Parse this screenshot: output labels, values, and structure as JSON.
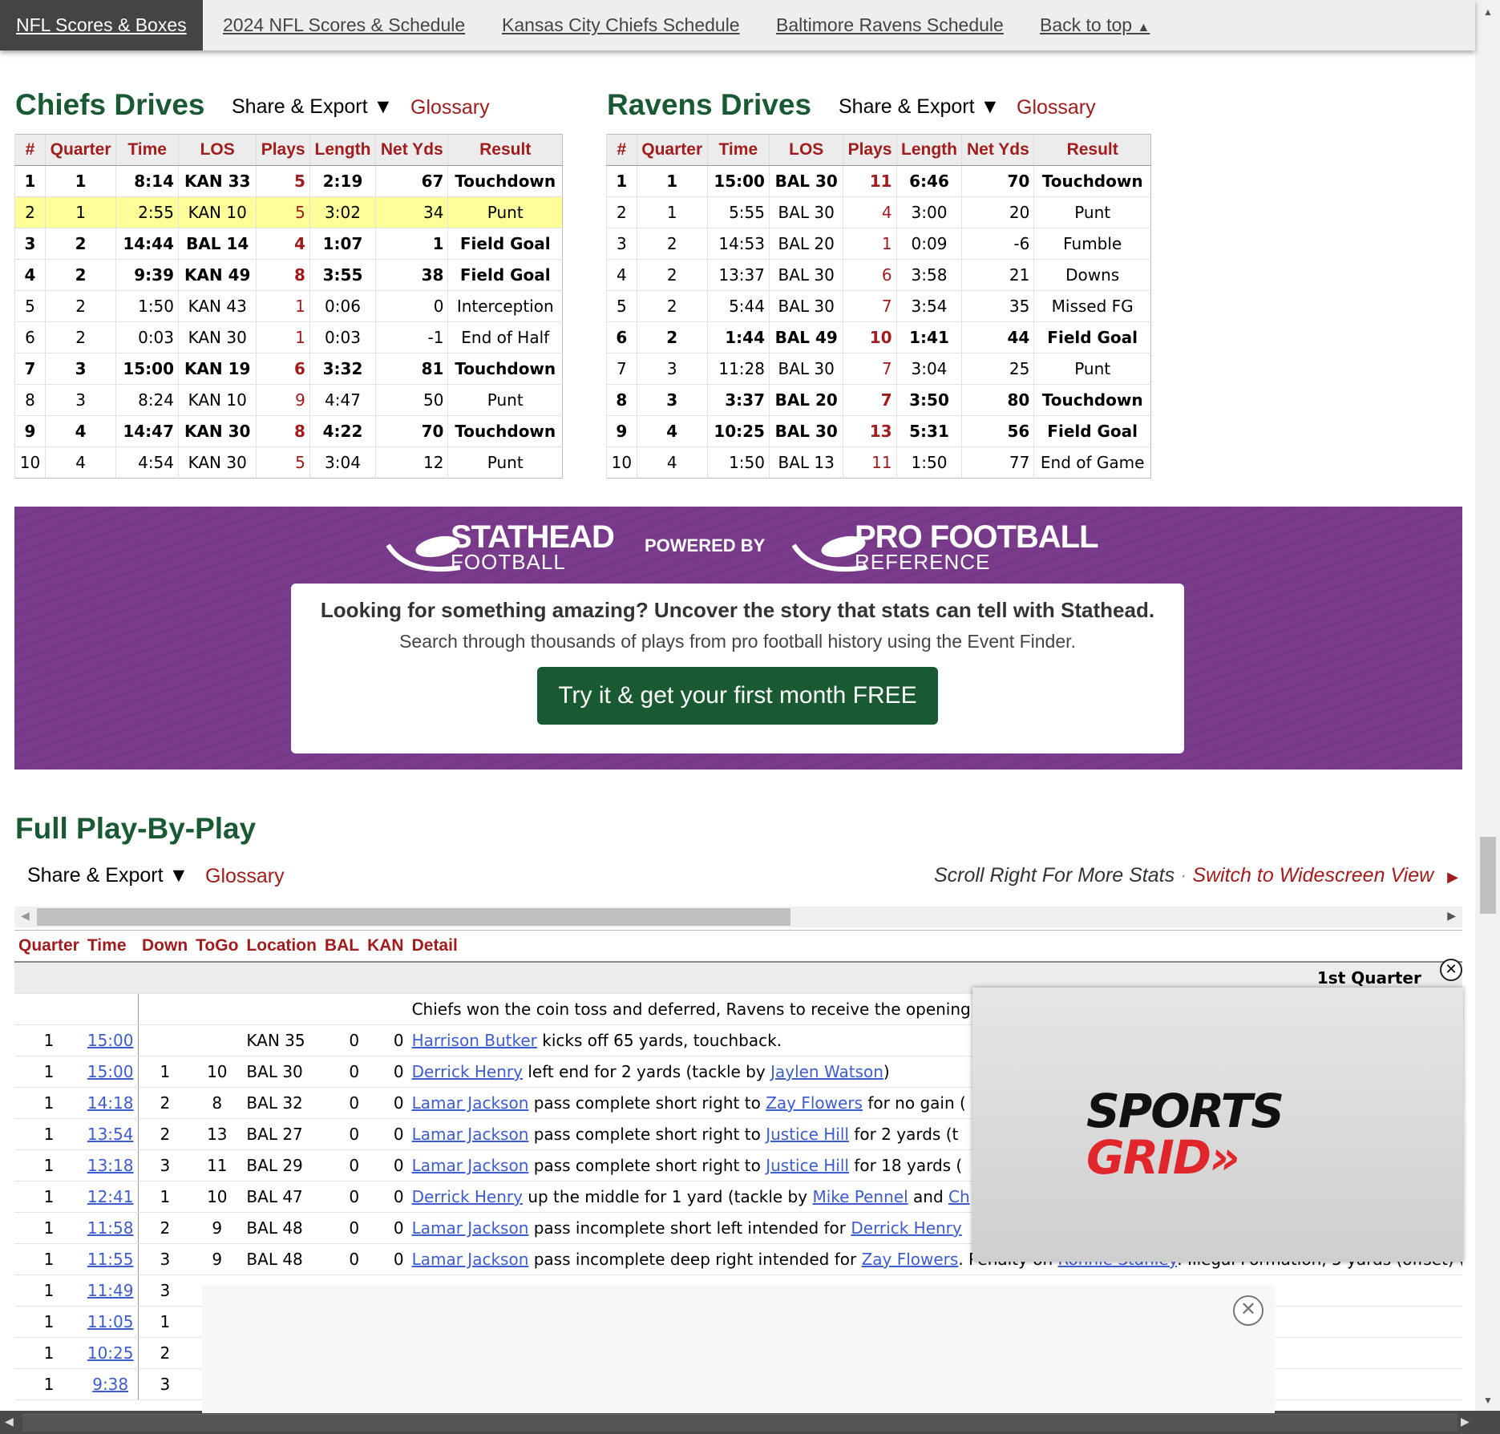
{
  "topnav": {
    "items": [
      "NFL Scores & Boxes",
      "2024 NFL Scores & Schedule",
      "Kansas City Chiefs Schedule",
      "Baltimore Ravens Schedule",
      "Back to top"
    ]
  },
  "chiefs": {
    "title": "Chiefs Drives",
    "share": "Share & Export ▼",
    "glossary": "Glossary",
    "columns": [
      "#",
      "Quarter",
      "Time",
      "LOS",
      "Plays",
      "Length",
      "Net Yds",
      "Result"
    ],
    "rows": [
      [
        "1",
        "1",
        "8:14",
        "KAN 33",
        "5",
        "2:19",
        "67",
        "Touchdown"
      ],
      [
        "2",
        "1",
        "2:55",
        "KAN 10",
        "5",
        "3:02",
        "34",
        "Punt"
      ],
      [
        "3",
        "2",
        "14:44",
        "BAL 14",
        "4",
        "1:07",
        "1",
        "Field Goal"
      ],
      [
        "4",
        "2",
        "9:39",
        "KAN 49",
        "8",
        "3:55",
        "38",
        "Field Goal"
      ],
      [
        "5",
        "2",
        "1:50",
        "KAN 43",
        "1",
        "0:06",
        "0",
        "Interception"
      ],
      [
        "6",
        "2",
        "0:03",
        "KAN 30",
        "1",
        "0:03",
        "-1",
        "End of Half"
      ],
      [
        "7",
        "3",
        "15:00",
        "KAN 19",
        "6",
        "3:32",
        "81",
        "Touchdown"
      ],
      [
        "8",
        "3",
        "8:24",
        "KAN 10",
        "9",
        "4:47",
        "50",
        "Punt"
      ],
      [
        "9",
        "4",
        "14:47",
        "KAN 30",
        "8",
        "4:22",
        "70",
        "Touchdown"
      ],
      [
        "10",
        "4",
        "4:54",
        "KAN 30",
        "5",
        "3:04",
        "12",
        "Punt"
      ]
    ]
  },
  "ravens": {
    "title": "Ravens Drives",
    "share": "Share & Export ▼",
    "glossary": "Glossary",
    "columns": [
      "#",
      "Quarter",
      "Time",
      "LOS",
      "Plays",
      "Length",
      "Net Yds",
      "Result"
    ],
    "rows": [
      [
        "1",
        "1",
        "15:00",
        "BAL 30",
        "11",
        "6:46",
        "70",
        "Touchdown"
      ],
      [
        "2",
        "1",
        "5:55",
        "BAL 30",
        "4",
        "3:00",
        "20",
        "Punt"
      ],
      [
        "3",
        "2",
        "14:53",
        "BAL 20",
        "1",
        "0:09",
        "-6",
        "Fumble"
      ],
      [
        "4",
        "2",
        "13:37",
        "BAL 30",
        "6",
        "3:58",
        "21",
        "Downs"
      ],
      [
        "5",
        "2",
        "5:44",
        "BAL 30",
        "7",
        "3:54",
        "35",
        "Missed FG"
      ],
      [
        "6",
        "2",
        "1:44",
        "BAL 49",
        "10",
        "1:41",
        "44",
        "Field Goal"
      ],
      [
        "7",
        "3",
        "11:28",
        "BAL 30",
        "7",
        "3:04",
        "25",
        "Punt"
      ],
      [
        "8",
        "3",
        "3:37",
        "BAL 20",
        "7",
        "3:50",
        "80",
        "Touchdown"
      ],
      [
        "9",
        "4",
        "10:25",
        "BAL 30",
        "13",
        "5:31",
        "56",
        "Field Goal"
      ],
      [
        "10",
        "4",
        "1:50",
        "BAL 13",
        "11",
        "1:50",
        "77",
        "End of Game"
      ]
    ]
  },
  "promo": {
    "stathead_big": "STATHEAD",
    "stathead_small": "FOOTBALL",
    "powered_by": "POWERED BY",
    "pfr_big": "PRO FOOTBALL",
    "pfr_small": "REFERENCE",
    "headline": "Looking for something amazing? Uncover the story that stats can tell with Stathead.",
    "subline": "Search through thousands of plays from pro football history using the Event Finder.",
    "cta": "Try it & get your first month FREE"
  },
  "pbp": {
    "title": "Full Play-By-Play",
    "share": "Share & Export ▼",
    "glossary": "Glossary",
    "scroll_note": "Scroll Right For More Stats",
    "widescreen": "Switch to Widescreen View",
    "columns": [
      "Quarter",
      "Time",
      "Down",
      "ToGo",
      "Location",
      "BAL",
      "KAN",
      "Detail"
    ],
    "quarter_label": "1st Quarter",
    "coin_toss": "Chiefs won the coin toss and deferred, Ravens to receive the opening kickoff.",
    "rows": [
      {
        "q": "1",
        "time": "15:00",
        "down": "",
        "togo": "",
        "loc": "KAN 35",
        "bal": "0",
        "kan": "0",
        "parts": [
          {
            "link": "Harrison Butker"
          },
          {
            "text": " kicks off 65 yards, touchback."
          }
        ]
      },
      {
        "q": "1",
        "time": "15:00",
        "down": "1",
        "togo": "10",
        "loc": "BAL 30",
        "bal": "0",
        "kan": "0",
        "parts": [
          {
            "link": "Derrick Henry"
          },
          {
            "text": " left end for 2 yards (tackle by "
          },
          {
            "link": "Jaylen Watson"
          },
          {
            "text": ")"
          }
        ]
      },
      {
        "q": "1",
        "time": "14:18",
        "down": "2",
        "togo": "8",
        "loc": "BAL 32",
        "bal": "0",
        "kan": "0",
        "parts": [
          {
            "link": "Lamar Jackson"
          },
          {
            "text": " pass complete short right to "
          },
          {
            "link": "Zay Flowers"
          },
          {
            "text": " for no gain ("
          }
        ]
      },
      {
        "q": "1",
        "time": "13:54",
        "down": "2",
        "togo": "13",
        "loc": "BAL 27",
        "bal": "0",
        "kan": "0",
        "parts": [
          {
            "link": "Lamar Jackson"
          },
          {
            "text": " pass complete short right to "
          },
          {
            "link": "Justice Hill"
          },
          {
            "text": " for 2 yards (t"
          }
        ]
      },
      {
        "q": "1",
        "time": "13:18",
        "down": "3",
        "togo": "11",
        "loc": "BAL 29",
        "bal": "0",
        "kan": "0",
        "parts": [
          {
            "link": "Lamar Jackson"
          },
          {
            "text": " pass complete short right to "
          },
          {
            "link": "Justice Hill"
          },
          {
            "text": " for 18 yards ("
          }
        ]
      },
      {
        "q": "1",
        "time": "12:41",
        "down": "1",
        "togo": "10",
        "loc": "BAL 47",
        "bal": "0",
        "kan": "0",
        "parts": [
          {
            "link": "Derrick Henry"
          },
          {
            "text": " up the middle for 1 yard (tackle by "
          },
          {
            "link": "Mike Pennel"
          },
          {
            "text": " and "
          },
          {
            "link": "Ch"
          }
        ]
      },
      {
        "q": "1",
        "time": "11:58",
        "down": "2",
        "togo": "9",
        "loc": "BAL 48",
        "bal": "0",
        "kan": "0",
        "parts": [
          {
            "link": "Lamar Jackson"
          },
          {
            "text": " pass incomplete short left intended for "
          },
          {
            "link": "Derrick Henry"
          }
        ]
      },
      {
        "q": "1",
        "time": "11:55",
        "down": "3",
        "togo": "9",
        "loc": "BAL 48",
        "bal": "0",
        "kan": "0",
        "parts": [
          {
            "link": "Lamar Jackson"
          },
          {
            "text": " pass incomplete deep right intended for "
          },
          {
            "link": "Zay Flowers"
          },
          {
            "text": ". Penalty on "
          },
          {
            "link": "Ronnie Stanley"
          },
          {
            "text": ": Illegal Formation, 5 yards (offset) ("
          }
        ]
      },
      {
        "q": "1",
        "time": "11:49",
        "down": "3",
        "togo": "",
        "loc": "",
        "bal": "",
        "kan": "",
        "parts": []
      },
      {
        "q": "1",
        "time": "11:05",
        "down": "1",
        "togo": "",
        "loc": "",
        "bal": "",
        "kan": "",
        "parts": []
      },
      {
        "q": "1",
        "time": "10:25",
        "down": "2",
        "togo": "",
        "loc": "",
        "bal": "",
        "kan": "",
        "parts": []
      },
      {
        "q": "1",
        "time": "9:38",
        "down": "3",
        "togo": "",
        "loc": "",
        "bal": "",
        "kan": "",
        "parts": []
      }
    ]
  },
  "video": {
    "brand_top": "SPORTS",
    "brand_bottom": "GRID»"
  },
  "icons": {
    "close": "close-icon",
    "ad_close": "close-icon"
  }
}
